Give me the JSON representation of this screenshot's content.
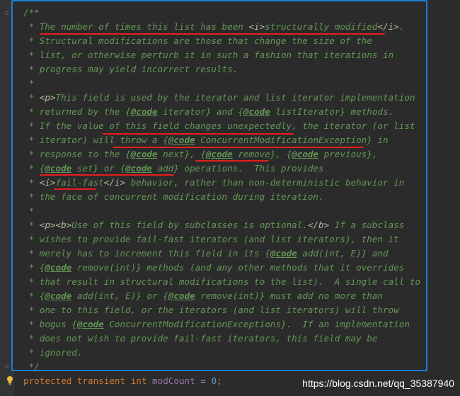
{
  "editor": {
    "comment_lines": [
      "/**",
      " * The number of times this list has been <i>structurally modified</i>.",
      " * Structural modifications are those that change the size of the",
      " * list, or otherwise perturb it in such a fashion that iterations in",
      " * progress may yield incorrect results.",
      " *",
      " * <p>This field is used by the iterator and list iterator implementation",
      " * returned by the {@code iterator} and {@code listIterator} methods.",
      " * If the value of this field changes unexpectedly, the iterator (or list",
      " * iterator) will throw a {@code ConcurrentModificationException} in",
      " * response to the {@code next}, {@code remove}, {@code previous},",
      " * {@code set} or {@code add} operations.  This provides",
      " * <i>fail-fast</i> behavior, rather than non-deterministic behavior in",
      " * the face of concurrent modification during iteration.",
      " *",
      " * <p><b>Use of this field by subclasses is optional.</b> If a subclass",
      " * wishes to provide fail-fast iterators (and list iterators), then it",
      " * merely has to increment this field in its {@code add(int, E)} and",
      " * {@code remove(int)} methods (and any other methods that it overrides",
      " * that result in structural modifications to the list).  A single call to",
      " * {@code add(int, E)} or {@code remove(int)} must add no more than",
      " * one to this field, or the iterators (and list iterators) will throw",
      " * bogus {@code ConcurrentModificationExceptions}.  If an implementation",
      " * does not wish to provide fail-fast iterators, this field may be",
      " * ignored.",
      " */"
    ],
    "declaration": {
      "kw1": "protected",
      "kw2": "transient",
      "kw3": "int",
      "field": "modCount",
      "assign": " = ",
      "value": "0",
      "semi": ";"
    },
    "colors": {
      "background": "#2b2b2b",
      "comment": "#629755",
      "keyword": "#cc7832",
      "field": "#9876aa",
      "number": "#6897bb",
      "selection_border": "#1e7ed6",
      "annotation_underline": "#e51e1e"
    }
  },
  "watermark": "https://blog.csdn.net/qq_35387940",
  "icons": {
    "intention": "lightbulb-icon"
  }
}
